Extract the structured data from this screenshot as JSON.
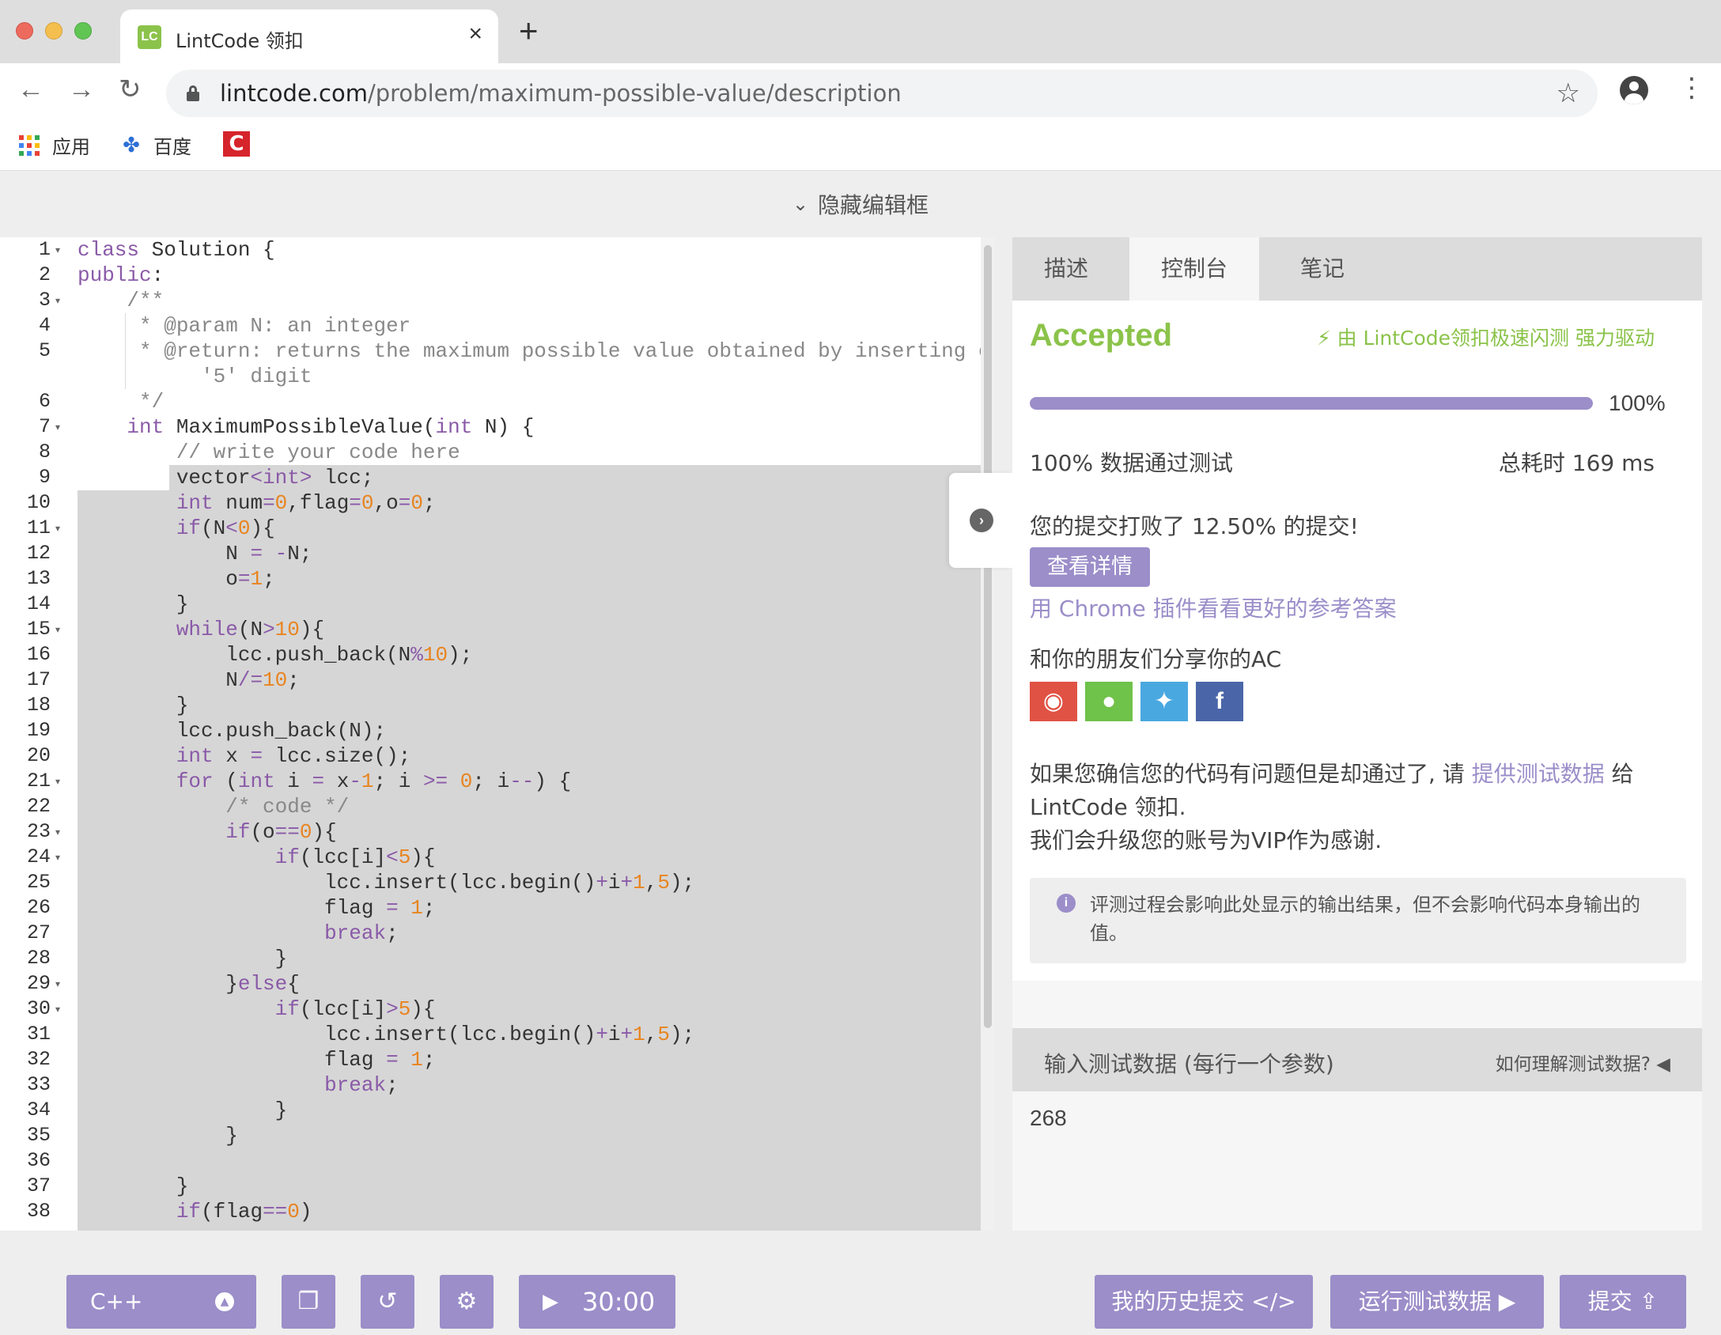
{
  "browser": {
    "tab_title": "LintCode 领扣",
    "tab_favicon": "LC",
    "url_host": "lintcode.com",
    "url_path": "/problem/maximum-possible-value/description",
    "bookmarks": [
      {
        "label": "应用"
      },
      {
        "label": "百度"
      }
    ]
  },
  "page": {
    "hide_editor_label": "隐藏编辑框"
  },
  "editor": {
    "line_numbers": [
      "1",
      "2",
      "3",
      "4",
      "5",
      "",
      "6",
      "7",
      "8",
      "9",
      "10",
      "11",
      "12",
      "13",
      "14",
      "15",
      "16",
      "17",
      "18",
      "19",
      "20",
      "21",
      "22",
      "23",
      "24",
      "25",
      "26",
      "27",
      "28",
      "29",
      "30",
      "31",
      "32",
      "33",
      "34",
      "35",
      "36",
      "37",
      "38"
    ],
    "language": "C++",
    "timer": "30:00"
  },
  "panel": {
    "tabs": [
      {
        "label": "描述"
      },
      {
        "label": "控制台"
      },
      {
        "label": "笔记"
      }
    ],
    "status": "Accepted",
    "powered_by": "由 LintCode领扣极速闪测 强力驱动",
    "progress_percent": 100,
    "progress_label": "100%",
    "pass_text": "100% 数据通过测试",
    "time_text": "总耗时 169 ms",
    "beat_text": "您的提交打败了 12.50% 的提交!",
    "detail_button": "查看详情",
    "chrome_link": "用 Chrome 插件看看更好的参考答案",
    "share_text": "和你的朋友们分享你的AC",
    "feedback_pre": "如果您确信您的代码有问题但是却通过了, 请 ",
    "feedback_link": "提供测试数据",
    "feedback_post": " 给 LintCode 领扣.",
    "feedback_line2": "我们会升级您的账号为VIP作为感谢.",
    "note": "评测过程会影响此处显示的输出结果，但不会影响代码本身输出的值。",
    "input_title": "输入测试数据 (每行一个参数)",
    "input_help": "如何理解测试数据?",
    "input_value": "268"
  },
  "bottom": {
    "history_button": "我的历史提交",
    "run_button": "运行测试数据",
    "submit_button": "提交"
  },
  "colors": {
    "accent": "#9b8ec9",
    "accepted": "#8bc34a"
  }
}
